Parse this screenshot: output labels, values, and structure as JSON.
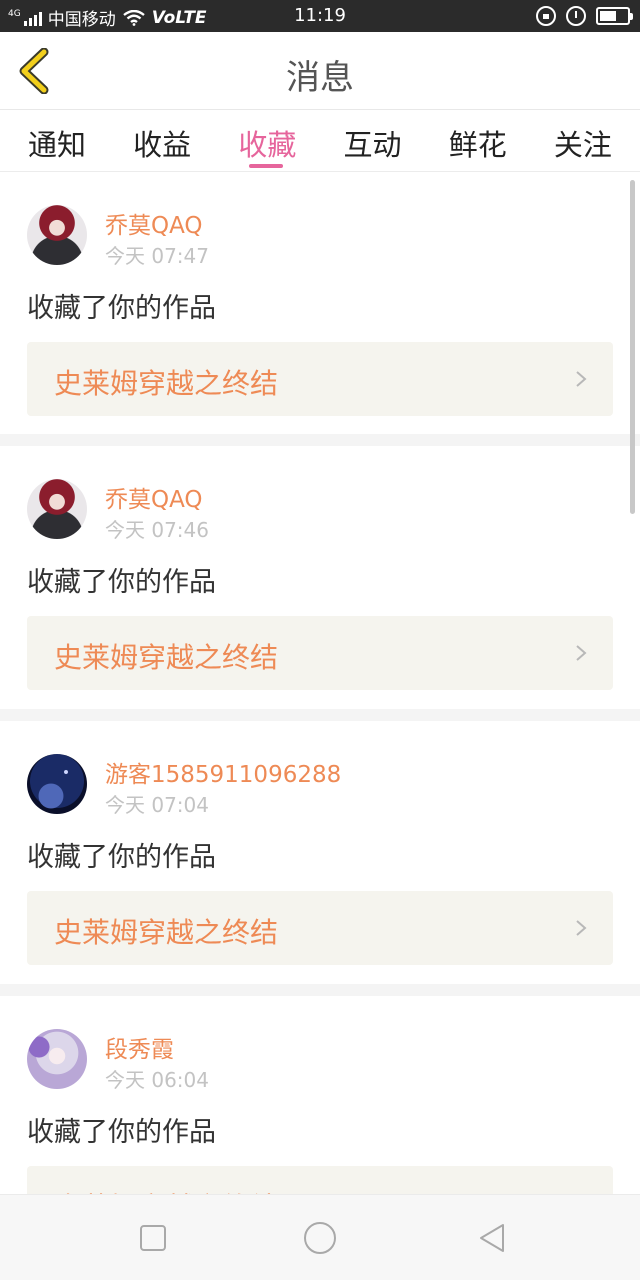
{
  "status_bar": {
    "network_type": "4G",
    "carrier": "中国移动",
    "volte": "VoLTE",
    "time": "11:19",
    "battery_level": 0.6
  },
  "header": {
    "back_icon": "chevron-left-icon",
    "title": "消息",
    "accent_color": "#f2cf1b"
  },
  "tabs": [
    {
      "label": "通知",
      "active": false
    },
    {
      "label": "收益",
      "active": false
    },
    {
      "label": "收藏",
      "active": true
    },
    {
      "label": "互动",
      "active": false
    },
    {
      "label": "鲜花",
      "active": false
    },
    {
      "label": "关注",
      "active": false
    }
  ],
  "colors": {
    "active_tab": "#e6659c",
    "user_name": "#ee8a55",
    "work_title": "#ee8a55",
    "work_card_bg": "#f5f4ee"
  },
  "messages": [
    {
      "user": "乔莫QAQ",
      "time": "今天 07:47",
      "action": "收藏了你的作品",
      "work": "史莱姆穿越之终结"
    },
    {
      "user": "乔莫QAQ",
      "time": "今天 07:46",
      "action": "收藏了你的作品",
      "work": "史莱姆穿越之终结"
    },
    {
      "user": "游客1585911096288",
      "time": "今天 07:04",
      "action": "收藏了你的作品",
      "work": "史莱姆穿越之终结"
    },
    {
      "user": "段秀霞",
      "time": "今天 06:04",
      "action": "收藏了你的作品",
      "work": "史莱姆穿越之终结"
    }
  ],
  "nav_bar": {
    "icons": [
      "square-icon",
      "circle-icon",
      "triangle-back-icon"
    ]
  }
}
